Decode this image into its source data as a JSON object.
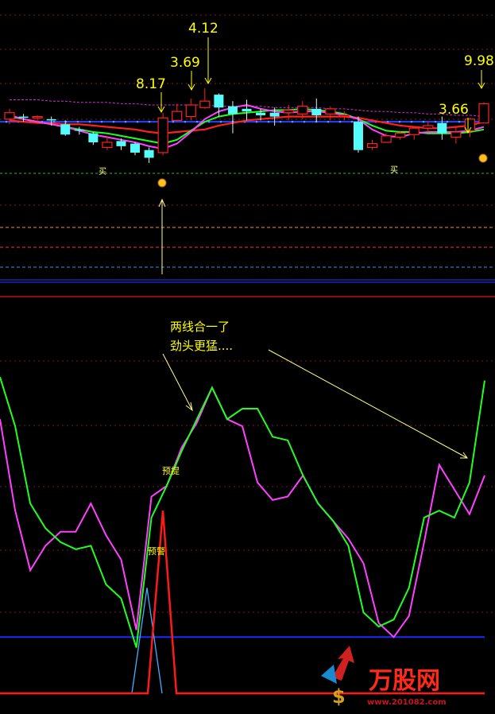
{
  "chart_data": [
    {
      "type": "candlestick",
      "title": "",
      "colors": {
        "up": "#ff2020",
        "down": "#54fcfc",
        "ma_short": "#ff40ff",
        "ma_mid": "#20ff20",
        "ma_long": "#ff2020",
        "ma_longest": "#cc33cc",
        "flat_line": "#2244ff"
      },
      "grid": true,
      "ylim": [
        0,
        100
      ],
      "candles": [
        {
          "o": 68,
          "c": 73,
          "h": 76,
          "l": 64
        },
        {
          "o": 70,
          "c": 69,
          "h": 72,
          "l": 66
        },
        {
          "o": 69,
          "c": 70,
          "h": 71,
          "l": 66
        },
        {
          "o": 68,
          "c": 67,
          "h": 70,
          "l": 63
        },
        {
          "o": 64,
          "c": 56,
          "h": 67,
          "l": 55
        },
        {
          "o": 60,
          "c": 59,
          "h": 62,
          "l": 56
        },
        {
          "o": 57,
          "c": 50,
          "h": 58,
          "l": 48
        },
        {
          "o": 46,
          "c": 50,
          "h": 55,
          "l": 44
        },
        {
          "o": 51,
          "c": 47,
          "h": 53,
          "l": 44
        },
        {
          "o": 49,
          "c": 42,
          "h": 50,
          "l": 40
        },
        {
          "o": 44,
          "c": 38,
          "h": 46,
          "l": 34
        },
        {
          "o": 42,
          "c": 69,
          "h": 73,
          "l": 40
        },
        {
          "o": 67,
          "c": 74,
          "h": 80,
          "l": 66
        },
        {
          "o": 70,
          "c": 79,
          "h": 84,
          "l": 67
        },
        {
          "o": 77,
          "c": 82,
          "h": 92,
          "l": 76
        },
        {
          "o": 87,
          "c": 77,
          "h": 88,
          "l": 70
        },
        {
          "o": 78,
          "c": 72,
          "h": 82,
          "l": 57
        },
        {
          "o": 76,
          "c": 74,
          "h": 83,
          "l": 67
        },
        {
          "o": 73,
          "c": 71,
          "h": 76,
          "l": 67
        },
        {
          "o": 73,
          "c": 70,
          "h": 77,
          "l": 63
        },
        {
          "o": 73,
          "c": 75,
          "h": 79,
          "l": 67
        },
        {
          "o": 72,
          "c": 78,
          "h": 82,
          "l": 68
        },
        {
          "o": 76,
          "c": 71,
          "h": 84,
          "l": 66
        },
        {
          "o": 72,
          "c": 76,
          "h": 78,
          "l": 67
        },
        {
          "o": 70,
          "c": 71,
          "h": 74,
          "l": 67
        },
        {
          "o": 66,
          "c": 44,
          "h": 70,
          "l": 42
        },
        {
          "o": 46,
          "c": 49,
          "h": 52,
          "l": 44
        },
        {
          "o": 50,
          "c": 55,
          "h": 57,
          "l": 50
        },
        {
          "o": 54,
          "c": 57,
          "h": 59,
          "l": 52
        },
        {
          "o": 56,
          "c": 61,
          "h": 62,
          "l": 52
        },
        {
          "o": 61,
          "c": 63,
          "h": 66,
          "l": 58
        },
        {
          "o": 65,
          "c": 57,
          "h": 70,
          "l": 52
        },
        {
          "o": 54,
          "c": 58,
          "h": 62,
          "l": 49
        },
        {
          "o": 59,
          "c": 68,
          "h": 69,
          "l": 54
        },
        {
          "o": 65,
          "c": 80,
          "h": 81,
          "l": 65
        }
      ],
      "ma_short": [
        71,
        68,
        66,
        64,
        62,
        59,
        56,
        54,
        52,
        50,
        47,
        45,
        49,
        58,
        68,
        74,
        77,
        79,
        76,
        74,
        73,
        74,
        74,
        73,
        71,
        68,
        60,
        55,
        54,
        57,
        58,
        58,
        58,
        59,
        62
      ],
      "ma_mid": [
        70,
        68,
        66,
        64,
        62,
        60,
        58,
        57,
        55,
        53,
        51,
        49,
        52,
        59,
        66,
        70,
        72,
        73,
        74,
        75,
        75,
        76,
        75,
        74,
        72,
        68,
        63,
        59,
        58,
        58,
        57,
        57,
        57,
        58,
        60
      ],
      "ma_long": [
        67,
        66,
        65,
        65,
        64,
        64,
        63,
        62,
        61,
        60,
        58,
        57,
        58,
        59,
        60,
        63,
        65,
        67,
        68,
        69,
        70,
        70,
        70,
        70,
        70,
        69,
        67,
        65,
        63,
        62,
        61,
        61,
        62,
        63,
        66
      ],
      "ma_longest": [
        83,
        83,
        83,
        82,
        82,
        81,
        81,
        81,
        80,
        80,
        79,
        79,
        79,
        79,
        79,
        78,
        78,
        78,
        78,
        77,
        77,
        77,
        77,
        76,
        76,
        75,
        74,
        74,
        73,
        73,
        72,
        72,
        71,
        71,
        70
      ],
      "flat_line": 66,
      "price_annotations": [
        "8.17",
        "3.69",
        "4.12",
        "3.66",
        "9.98"
      ],
      "buy_label": "买"
    },
    {
      "type": "line",
      "title": "",
      "ylim": [
        0,
        100
      ],
      "grid": true,
      "series": [
        {
          "color": "#ff40ff",
          "values": [
            78,
            52,
            35,
            42,
            46,
            46,
            54,
            45,
            38,
            18,
            56,
            59,
            70,
            77,
            87,
            78,
            76,
            60,
            55,
            56,
            62,
            54,
            49,
            44,
            37,
            20,
            16,
            22,
            43,
            65,
            58,
            51,
            62
          ]
        },
        {
          "color": "#20ff20",
          "values": [
            90,
            76,
            54,
            47,
            43,
            41,
            42,
            31,
            27,
            13,
            50,
            59,
            69,
            78,
            87,
            78,
            81,
            81,
            73,
            72,
            62,
            54,
            49,
            42,
            23,
            19,
            21,
            30,
            50,
            52,
            50,
            60,
            89
          ]
        }
      ],
      "blue_line": 16,
      "red_pulse": [
        0,
        0,
        0,
        0,
        0,
        0,
        0,
        0,
        0,
        0,
        52,
        0,
        0
      ],
      "blue_pulse": [
        0,
        0,
        0,
        0,
        0,
        0,
        0,
        0,
        0,
        30,
        0,
        0,
        0
      ],
      "annotations": {
        "note_line1": "两线合一了",
        "note_line2": "劲头更猛....",
        "pre_raise": "预提",
        "pre_warn": "预警"
      }
    }
  ],
  "watermark": {
    "brand": "万股网",
    "url": "www.201082.com"
  }
}
